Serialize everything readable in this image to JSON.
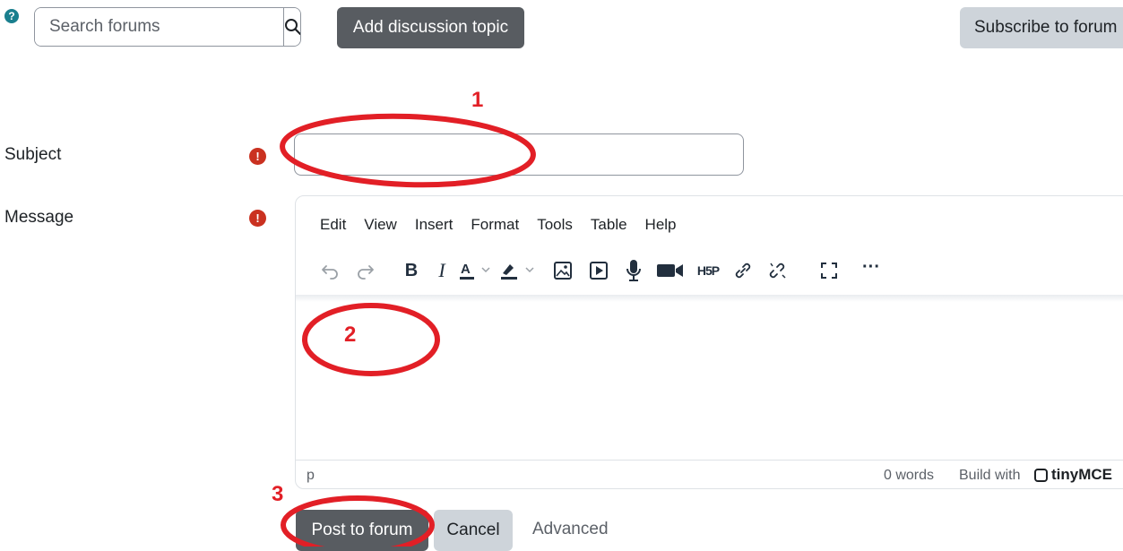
{
  "header": {
    "help_icon_glyph": "?",
    "search_placeholder": "Search forums",
    "add_topic_label": "Add discussion topic",
    "subscribe_label": "Subscribe to forum"
  },
  "form": {
    "subject_label": "Subject",
    "message_label": "Message",
    "required_glyph": "!",
    "subject_value": ""
  },
  "editor": {
    "menu": [
      "Edit",
      "View",
      "Insert",
      "Format",
      "Tools",
      "Table",
      "Help"
    ],
    "toolbar_icons": [
      "undo-icon",
      "redo-icon",
      "bold-icon",
      "italic-icon",
      "text-color-icon",
      "highlight-color-icon",
      "image-icon",
      "media-icon",
      "microphone-icon",
      "video-icon",
      "h5p-icon",
      "link-icon",
      "unlink-icon",
      "fullscreen-icon",
      "more-icon"
    ],
    "status_path": "p",
    "word_count": "0 words",
    "build_with": "Build with",
    "brand": "tinyMCE"
  },
  "actions": {
    "post_label": "Post to forum",
    "cancel_label": "Cancel",
    "advanced_label": "Advanced"
  },
  "annotations": {
    "marks": [
      "1",
      "2",
      "3"
    ],
    "color": "#e21f26"
  },
  "colors": {
    "dark_button": "#585c61",
    "light_button": "#ced4da",
    "required": "#ca3120"
  }
}
